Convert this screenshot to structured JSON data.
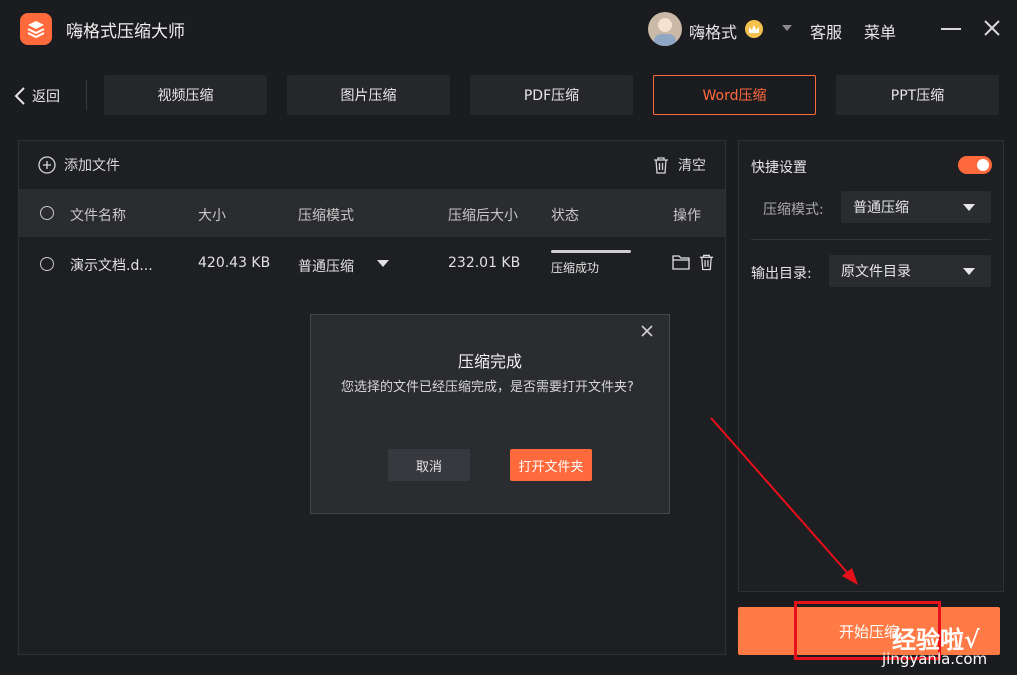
{
  "app": {
    "title": "嗨格式压缩大师"
  },
  "user": {
    "name": "嗨格式",
    "avatar_icon": "user-avatar",
    "vip_icon": "vip-crown-icon"
  },
  "header": {
    "service_label": "客服",
    "menu_label": "菜单"
  },
  "nav": {
    "back_label": "返回",
    "tabs": [
      {
        "label": "视频压缩",
        "active": false
      },
      {
        "label": "图片压缩",
        "active": false
      },
      {
        "label": "PDF压缩",
        "active": false
      },
      {
        "label": "Word压缩",
        "active": true
      },
      {
        "label": "PPT压缩",
        "active": false
      }
    ]
  },
  "toolbar": {
    "add_file_label": "添加文件",
    "clear_label": "清空"
  },
  "table": {
    "headers": [
      "文件名称",
      "大小",
      "压缩模式",
      "压缩后大小",
      "状态",
      "操作"
    ],
    "rows": [
      {
        "name": "演示文档.d...",
        "size": "420.43 KB",
        "mode": "普通压缩",
        "compressed_size": "232.01 KB",
        "status": "压缩成功",
        "progress": 1.0
      }
    ]
  },
  "settings": {
    "quick_label": "快捷设置",
    "quick_enabled": true,
    "mode_label": "压缩模式:",
    "mode_value": "普通压缩",
    "output_label": "输出目录:",
    "output_value": "原文件目录"
  },
  "start_button": {
    "label": "开始压缩"
  },
  "dialog": {
    "title": "压缩完成",
    "message": "您选择的文件已经压缩完成，是否需要打开文件夹?",
    "cancel_label": "取消",
    "open_label": "打开文件夹"
  },
  "watermark": {
    "main": "经验啦√",
    "sub": "jingyanla.com"
  },
  "colors": {
    "accent": "#ff6a3d",
    "background": "#1b1c1f",
    "annotation": "#e8101a"
  }
}
